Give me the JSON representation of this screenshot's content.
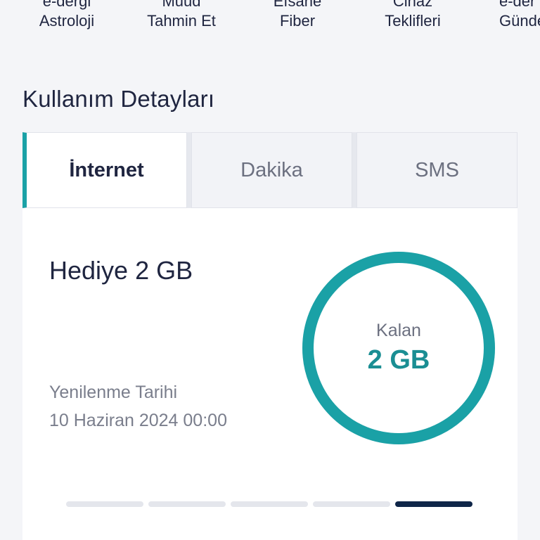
{
  "shortcuts": [
    {
      "line1": "e-dergi",
      "line2": "Astroloji"
    },
    {
      "line1": "Muud",
      "line2": "Tahmin Et"
    },
    {
      "line1": "Efsane",
      "line2": "Fiber"
    },
    {
      "line1": "Cihaz",
      "line2": "Teklifleri"
    },
    {
      "line1": "e-der",
      "line2": "Günde"
    }
  ],
  "usage": {
    "title": "Kullanım Detayları",
    "tabs": [
      {
        "label": "İnternet",
        "active": true
      },
      {
        "label": "Dakika",
        "active": false
      },
      {
        "label": "SMS",
        "active": false
      }
    ],
    "card": {
      "package_name": "Hediye 2 GB",
      "renew_label": "Yenilenme Tarihi",
      "renew_date": "10 Haziran 2024 00:00",
      "remaining_label": "Kalan",
      "remaining_value": "2 GB",
      "remaining_fraction": 1.0
    },
    "pager": {
      "count": 5,
      "active_index": 4
    }
  },
  "colors": {
    "accent": "#1aa1a6",
    "ring": "#1aa1a6",
    "value": "#1a8e93",
    "pager_active": "#0f2648",
    "text_primary": "#1f2540",
    "text_secondary": "#7a7e8c"
  }
}
